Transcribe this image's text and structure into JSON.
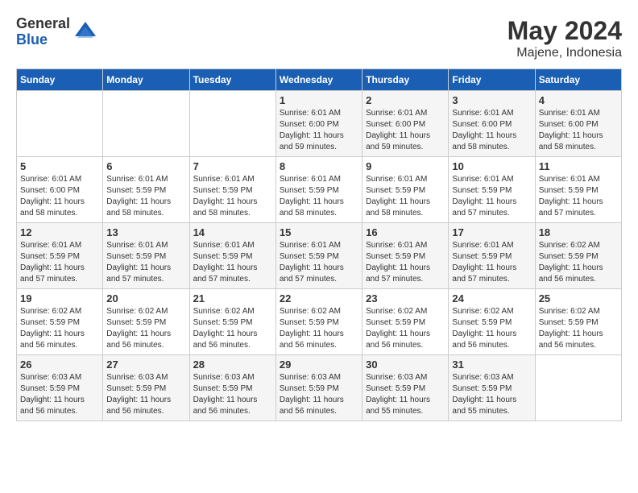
{
  "logo": {
    "general": "General",
    "blue": "Blue"
  },
  "title": {
    "month": "May 2024",
    "location": "Majene, Indonesia"
  },
  "headers": [
    "Sunday",
    "Monday",
    "Tuesday",
    "Wednesday",
    "Thursday",
    "Friday",
    "Saturday"
  ],
  "weeks": [
    [
      {
        "day": "",
        "sunrise": "",
        "sunset": "",
        "daylight": ""
      },
      {
        "day": "",
        "sunrise": "",
        "sunset": "",
        "daylight": ""
      },
      {
        "day": "",
        "sunrise": "",
        "sunset": "",
        "daylight": ""
      },
      {
        "day": "1",
        "sunrise": "Sunrise: 6:01 AM",
        "sunset": "Sunset: 6:00 PM",
        "daylight": "Daylight: 11 hours and 59 minutes."
      },
      {
        "day": "2",
        "sunrise": "Sunrise: 6:01 AM",
        "sunset": "Sunset: 6:00 PM",
        "daylight": "Daylight: 11 hours and 59 minutes."
      },
      {
        "day": "3",
        "sunrise": "Sunrise: 6:01 AM",
        "sunset": "Sunset: 6:00 PM",
        "daylight": "Daylight: 11 hours and 58 minutes."
      },
      {
        "day": "4",
        "sunrise": "Sunrise: 6:01 AM",
        "sunset": "Sunset: 6:00 PM",
        "daylight": "Daylight: 11 hours and 58 minutes."
      }
    ],
    [
      {
        "day": "5",
        "sunrise": "Sunrise: 6:01 AM",
        "sunset": "Sunset: 6:00 PM",
        "daylight": "Daylight: 11 hours and 58 minutes."
      },
      {
        "day": "6",
        "sunrise": "Sunrise: 6:01 AM",
        "sunset": "Sunset: 5:59 PM",
        "daylight": "Daylight: 11 hours and 58 minutes."
      },
      {
        "day": "7",
        "sunrise": "Sunrise: 6:01 AM",
        "sunset": "Sunset: 5:59 PM",
        "daylight": "Daylight: 11 hours and 58 minutes."
      },
      {
        "day": "8",
        "sunrise": "Sunrise: 6:01 AM",
        "sunset": "Sunset: 5:59 PM",
        "daylight": "Daylight: 11 hours and 58 minutes."
      },
      {
        "day": "9",
        "sunrise": "Sunrise: 6:01 AM",
        "sunset": "Sunset: 5:59 PM",
        "daylight": "Daylight: 11 hours and 58 minutes."
      },
      {
        "day": "10",
        "sunrise": "Sunrise: 6:01 AM",
        "sunset": "Sunset: 5:59 PM",
        "daylight": "Daylight: 11 hours and 57 minutes."
      },
      {
        "day": "11",
        "sunrise": "Sunrise: 6:01 AM",
        "sunset": "Sunset: 5:59 PM",
        "daylight": "Daylight: 11 hours and 57 minutes."
      }
    ],
    [
      {
        "day": "12",
        "sunrise": "Sunrise: 6:01 AM",
        "sunset": "Sunset: 5:59 PM",
        "daylight": "Daylight: 11 hours and 57 minutes."
      },
      {
        "day": "13",
        "sunrise": "Sunrise: 6:01 AM",
        "sunset": "Sunset: 5:59 PM",
        "daylight": "Daylight: 11 hours and 57 minutes."
      },
      {
        "day": "14",
        "sunrise": "Sunrise: 6:01 AM",
        "sunset": "Sunset: 5:59 PM",
        "daylight": "Daylight: 11 hours and 57 minutes."
      },
      {
        "day": "15",
        "sunrise": "Sunrise: 6:01 AM",
        "sunset": "Sunset: 5:59 PM",
        "daylight": "Daylight: 11 hours and 57 minutes."
      },
      {
        "day": "16",
        "sunrise": "Sunrise: 6:01 AM",
        "sunset": "Sunset: 5:59 PM",
        "daylight": "Daylight: 11 hours and 57 minutes."
      },
      {
        "day": "17",
        "sunrise": "Sunrise: 6:01 AM",
        "sunset": "Sunset: 5:59 PM",
        "daylight": "Daylight: 11 hours and 57 minutes."
      },
      {
        "day": "18",
        "sunrise": "Sunrise: 6:02 AM",
        "sunset": "Sunset: 5:59 PM",
        "daylight": "Daylight: 11 hours and 56 minutes."
      }
    ],
    [
      {
        "day": "19",
        "sunrise": "Sunrise: 6:02 AM",
        "sunset": "Sunset: 5:59 PM",
        "daylight": "Daylight: 11 hours and 56 minutes."
      },
      {
        "day": "20",
        "sunrise": "Sunrise: 6:02 AM",
        "sunset": "Sunset: 5:59 PM",
        "daylight": "Daylight: 11 hours and 56 minutes."
      },
      {
        "day": "21",
        "sunrise": "Sunrise: 6:02 AM",
        "sunset": "Sunset: 5:59 PM",
        "daylight": "Daylight: 11 hours and 56 minutes."
      },
      {
        "day": "22",
        "sunrise": "Sunrise: 6:02 AM",
        "sunset": "Sunset: 5:59 PM",
        "daylight": "Daylight: 11 hours and 56 minutes."
      },
      {
        "day": "23",
        "sunrise": "Sunrise: 6:02 AM",
        "sunset": "Sunset: 5:59 PM",
        "daylight": "Daylight: 11 hours and 56 minutes."
      },
      {
        "day": "24",
        "sunrise": "Sunrise: 6:02 AM",
        "sunset": "Sunset: 5:59 PM",
        "daylight": "Daylight: 11 hours and 56 minutes."
      },
      {
        "day": "25",
        "sunrise": "Sunrise: 6:02 AM",
        "sunset": "Sunset: 5:59 PM",
        "daylight": "Daylight: 11 hours and 56 minutes."
      }
    ],
    [
      {
        "day": "26",
        "sunrise": "Sunrise: 6:03 AM",
        "sunset": "Sunset: 5:59 PM",
        "daylight": "Daylight: 11 hours and 56 minutes."
      },
      {
        "day": "27",
        "sunrise": "Sunrise: 6:03 AM",
        "sunset": "Sunset: 5:59 PM",
        "daylight": "Daylight: 11 hours and 56 minutes."
      },
      {
        "day": "28",
        "sunrise": "Sunrise: 6:03 AM",
        "sunset": "Sunset: 5:59 PM",
        "daylight": "Daylight: 11 hours and 56 minutes."
      },
      {
        "day": "29",
        "sunrise": "Sunrise: 6:03 AM",
        "sunset": "Sunset: 5:59 PM",
        "daylight": "Daylight: 11 hours and 56 minutes."
      },
      {
        "day": "30",
        "sunrise": "Sunrise: 6:03 AM",
        "sunset": "Sunset: 5:59 PM",
        "daylight": "Daylight: 11 hours and 55 minutes."
      },
      {
        "day": "31",
        "sunrise": "Sunrise: 6:03 AM",
        "sunset": "Sunset: 5:59 PM",
        "daylight": "Daylight: 11 hours and 55 minutes."
      },
      {
        "day": "",
        "sunrise": "",
        "sunset": "",
        "daylight": ""
      }
    ]
  ]
}
